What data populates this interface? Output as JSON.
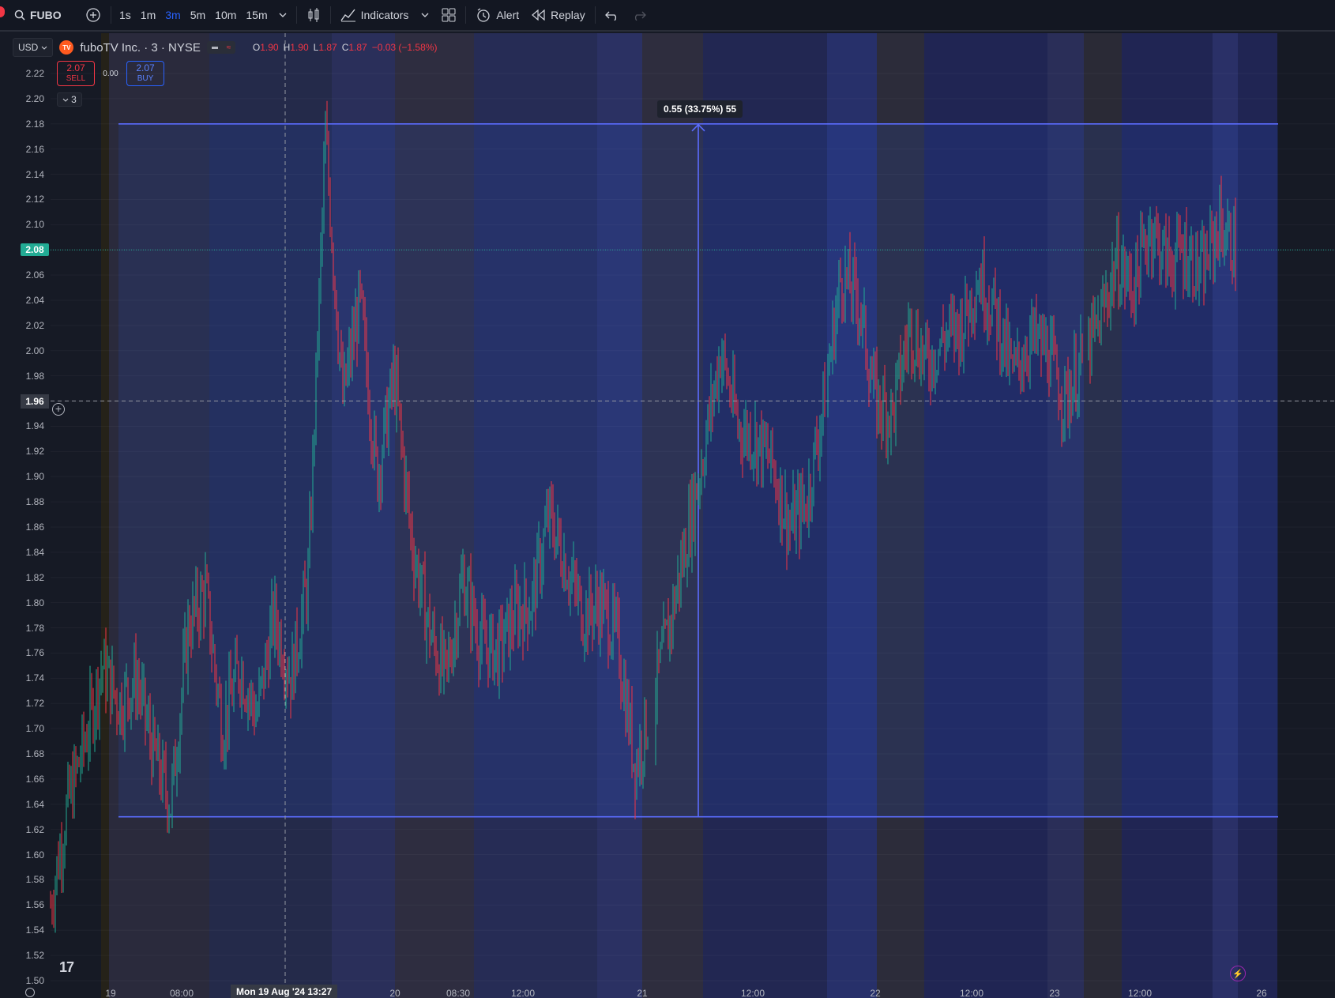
{
  "toolbar": {
    "symbol": "FUBO",
    "timeframes": [
      "1s",
      "1m",
      "3m",
      "5m",
      "10m",
      "15m"
    ],
    "active_timeframe": "3m",
    "indicators_label": "Indicators",
    "alert_label": "Alert",
    "replay_label": "Replay"
  },
  "legend": {
    "currency": "USD",
    "logo_text": "TV",
    "symbol_title": "fuboTV Inc. · 3 · NYSE",
    "ohlc": {
      "o_label": "O",
      "o": "1.90",
      "h_label": "H",
      "h": "1.90",
      "l_label": "L",
      "l": "1.87",
      "c_label": "C",
      "c": "1.87",
      "change": "−0.03 (−1.58%)"
    }
  },
  "trade": {
    "sell_price": "2.07",
    "sell_label": "SELL",
    "spread": "0.00",
    "buy_price": "2.07",
    "buy_label": "BUY",
    "collapse_count": "3"
  },
  "measure": {
    "label": "0.55 (33.75%) 55"
  },
  "price_axis": {
    "ticks": [
      "2.22",
      "2.20",
      "2.18",
      "2.16",
      "2.14",
      "2.12",
      "2.10",
      "2.08",
      "2.06",
      "2.04",
      "2.02",
      "2.00",
      "1.98",
      "1.96",
      "1.94",
      "1.92",
      "1.90",
      "1.88",
      "1.86",
      "1.84",
      "1.82",
      "1.80",
      "1.78",
      "1.76",
      "1.74",
      "1.72",
      "1.70",
      "1.68",
      "1.66",
      "1.64",
      "1.62",
      "1.60",
      "1.58",
      "1.56",
      "1.54",
      "1.52",
      "1.50"
    ],
    "current_price": "2.08",
    "crosshair_price": "1.96"
  },
  "time_axis": {
    "labels": [
      "19",
      "08:00",
      "20",
      "08:30",
      "12:00",
      "21",
      "12:00",
      "22",
      "12:00",
      "23",
      "12:00",
      "26"
    ],
    "crosshair_time": "Mon 19 Aug '24   13:27"
  },
  "logo": "17",
  "colors": {
    "up": "#22ab94",
    "down": "#f23645",
    "accent": "#2962ff",
    "measure": "#5b6cff"
  },
  "chart_data": {
    "type": "candlestick",
    "symbol": "FUBO",
    "interval": "3m",
    "ylim": [
      1.5,
      2.23
    ],
    "x_sessions": [
      "19",
      "20",
      "21",
      "22",
      "23",
      "26"
    ],
    "price_path": [
      1.56,
      1.64,
      1.69,
      1.75,
      1.72,
      1.74,
      1.68,
      1.64,
      1.78,
      1.81,
      1.7,
      1.75,
      1.71,
      1.79,
      1.74,
      1.82,
      2.17,
      1.96,
      2.04,
      1.9,
      1.98,
      1.85,
      1.78,
      1.74,
      1.82,
      1.77,
      1.76,
      1.79,
      1.8,
      1.87,
      1.83,
      1.79,
      1.8,
      1.77,
      1.67,
      1.72,
      1.78,
      1.85,
      1.92,
      2.0,
      1.94,
      1.93,
      1.91,
      1.86,
      1.88,
      1.96,
      2.06,
      2.04,
      1.96,
      1.95,
      2.02,
      1.99,
      2.01,
      2.02,
      2.06,
      2.03,
      1.98,
      2.01,
      2.0,
      1.96,
      1.99,
      2.02,
      2.07,
      2.05,
      2.1,
      2.07,
      2.08,
      2.06,
      2.1,
      2.08
    ],
    "measure": {
      "from": 1.63,
      "to": 2.18,
      "change": 0.55,
      "percent": 33.75,
      "bars": 55
    },
    "current_price": 2.08,
    "crosshair_price": 1.96,
    "crosshair_time": "Mon 19 Aug '24 13:27"
  }
}
